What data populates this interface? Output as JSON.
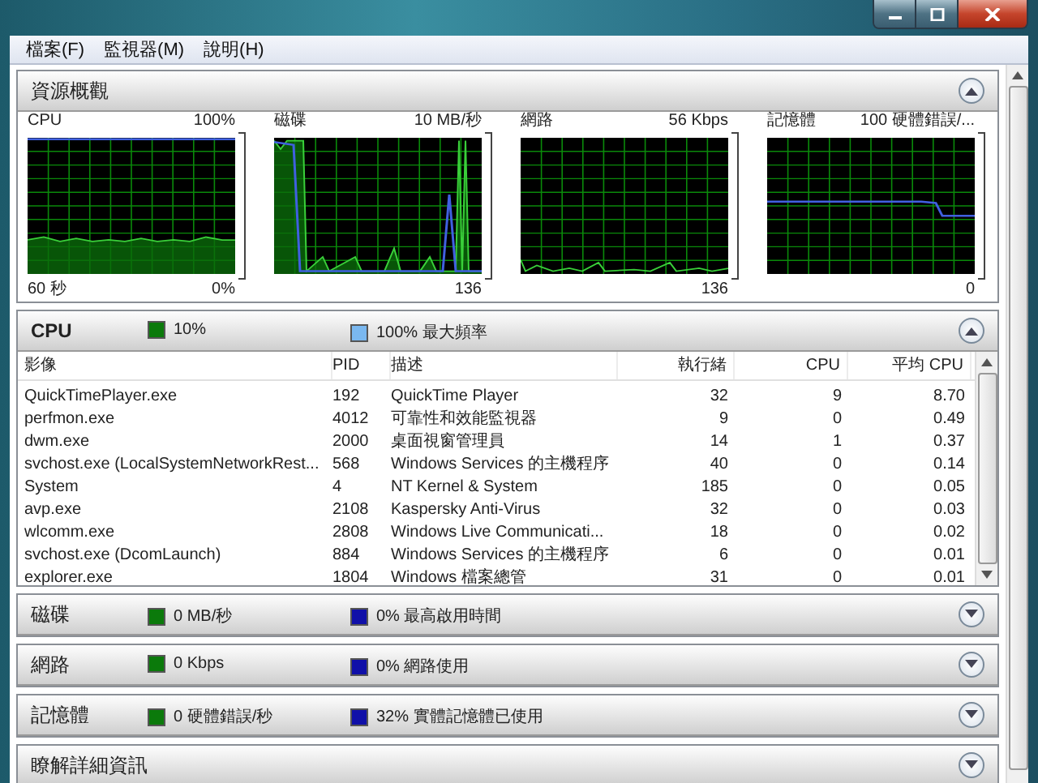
{
  "menu": [
    "檔案(F)",
    "監視器(M)",
    "說明(H)"
  ],
  "overview": {
    "title": "資源概觀",
    "expanded": true,
    "graphs": [
      {
        "kind": "cpu",
        "label": "CPU",
        "max": "100%",
        "time": "60 秒",
        "min": "0%"
      },
      {
        "kind": "disk",
        "label": "磁碟",
        "max": "10 MB/秒",
        "min": "136"
      },
      {
        "kind": "network",
        "label": "網路",
        "max": "56 Kbps",
        "min": "136"
      },
      {
        "kind": "memory",
        "label": "記憶體",
        "max": "100 硬體錯誤/...",
        "min": "0"
      }
    ]
  },
  "cpu": {
    "title": "CPU",
    "expanded": true,
    "legend": [
      {
        "text": "10%",
        "color": "#0b7a0b"
      },
      {
        "text": "100% 最大頻率",
        "color": "#7ab8f0"
      }
    ],
    "columns": [
      "影像",
      "PID",
      "描述",
      "執行緒",
      "CPU",
      "平均 CPU"
    ],
    "rows": [
      [
        "QuickTimePlayer.exe",
        "192",
        "QuickTime Player",
        "32",
        "9",
        "8.70"
      ],
      [
        "perfmon.exe",
        "4012",
        "可靠性和效能監視器",
        "9",
        "0",
        "0.49"
      ],
      [
        "dwm.exe",
        "2000",
        "桌面視窗管理員",
        "14",
        "1",
        "0.37"
      ],
      [
        "svchost.exe (LocalSystemNetworkRest...",
        "568",
        "Windows Services 的主機程序",
        "40",
        "0",
        "0.14"
      ],
      [
        "System",
        "4",
        "NT Kernel & System",
        "185",
        "0",
        "0.05"
      ],
      [
        "avp.exe",
        "2108",
        "Kaspersky Anti-Virus",
        "32",
        "0",
        "0.03"
      ],
      [
        "wlcomm.exe",
        "2808",
        "Windows Live Communicati...",
        "18",
        "0",
        "0.02"
      ],
      [
        "svchost.exe (DcomLaunch)",
        "884",
        "Windows Services 的主機程序",
        "6",
        "0",
        "0.01"
      ],
      [
        "explorer.exe",
        "1804",
        "Windows 檔案總管",
        "31",
        "0",
        "0.01"
      ]
    ]
  },
  "sections": [
    {
      "title": "磁碟",
      "expanded": false,
      "legend": [
        {
          "text": "0 MB/秒",
          "color": "#0b7a0b"
        },
        {
          "text": "0% 最高啟用時間",
          "color": "#1010a8"
        }
      ]
    },
    {
      "title": "網路",
      "expanded": false,
      "legend": [
        {
          "text": "0 Kbps",
          "color": "#0b7a0b"
        },
        {
          "text": "0% 網路使用",
          "color": "#1010a8"
        }
      ]
    },
    {
      "title": "記憶體",
      "expanded": false,
      "legend": [
        {
          "text": "0 硬體錯誤/秒",
          "color": "#0b7a0b"
        },
        {
          "text": "32% 實體記憶體已使用",
          "color": "#1010a8"
        }
      ]
    },
    {
      "title": "瞭解詳細資訊",
      "expanded": false
    }
  ]
}
